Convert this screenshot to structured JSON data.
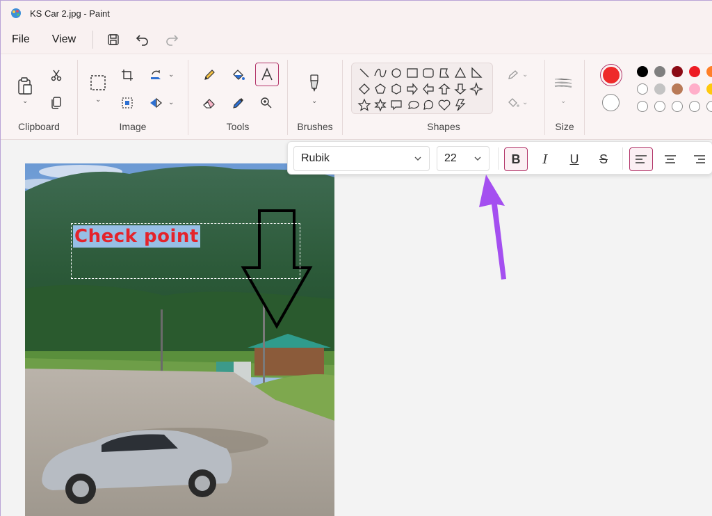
{
  "window": {
    "title": "KS Car 2.jpg - Paint"
  },
  "menu": {
    "file": "File",
    "view": "View"
  },
  "groups": {
    "clipboard": "Clipboard",
    "image": "Image",
    "tools": "Tools",
    "brushes": "Brushes",
    "shapes": "Shapes",
    "size": "Size"
  },
  "colors": {
    "primary": "#ee2a2a",
    "secondary": "#ffffff",
    "palette_row1": [
      "#000000",
      "#7f7f7f",
      "#8b0a14",
      "#ed1c24",
      "#ff7f27"
    ],
    "palette_row2": [
      "#ffffff",
      "#c3c3c3",
      "#b97a57",
      "#ffaec9",
      "#ffc90e"
    ],
    "accent": "#b3366a"
  },
  "text_toolbar": {
    "font": "Rubik",
    "size": "22",
    "bold": "B",
    "italic": "I",
    "underline": "U",
    "strike": "S"
  },
  "canvas": {
    "text": "Check point"
  }
}
